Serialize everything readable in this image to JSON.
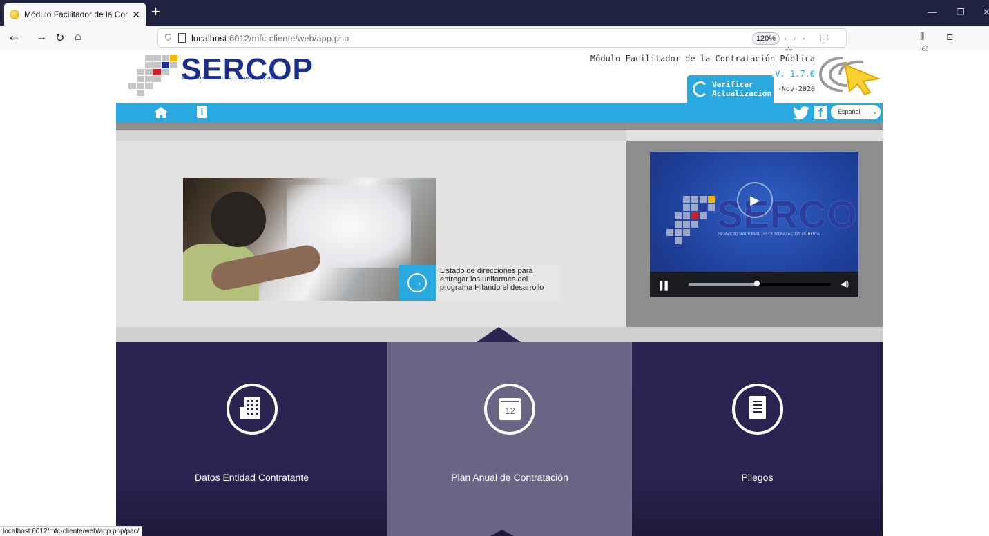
{
  "browser": {
    "tab_title": "Módulo Facilitador de la Contra",
    "tab_close": "✕",
    "new_tab": "+",
    "url_host": "localhost",
    "url_rest": ":6012/mfc-cliente/web/app.php",
    "zoom": "120%",
    "url_actions": "··· ☐ ☆",
    "status_url": "localhost:6012/mfc-cliente/web/app.php/pac/"
  },
  "header": {
    "logo_text": "SERCOP",
    "logo_sub": "SERVICIO NACIONAL DE CONTRATACIÓN PÚBLICA",
    "module_title": "Módulo Facilitador de la Contratación Pública",
    "version": "V. 1.7.0",
    "date": "-Nov-2020",
    "verify_line1": "Verificar",
    "verify_line2": "Actualización"
  },
  "navbar": {
    "info_label": "i",
    "fb_label": "f",
    "language": "Español"
  },
  "hero": {
    "caption": "Listado de direcciones para entregar los uniformes del programa Hilando el desarrollo",
    "video_logo": "SERCOP",
    "video_sub": "SERVICIO NACIONAL DE CONTRATACIÓN PÚBLICA",
    "video_progress": 0.48
  },
  "tiles": [
    {
      "label": "Datos Entidad Contratante",
      "icon": "building-icon"
    },
    {
      "label": "Plan Anual de Contratación",
      "icon": "calendar-icon",
      "icon_text": "12"
    },
    {
      "label": "Pliegos",
      "icon": "document-icon"
    }
  ],
  "colors": {
    "brand_blue": "#29a9e0",
    "logo_navy": "#1d2f8c",
    "tile_dark": "#2c2452",
    "tile_active": "#6b6485"
  }
}
